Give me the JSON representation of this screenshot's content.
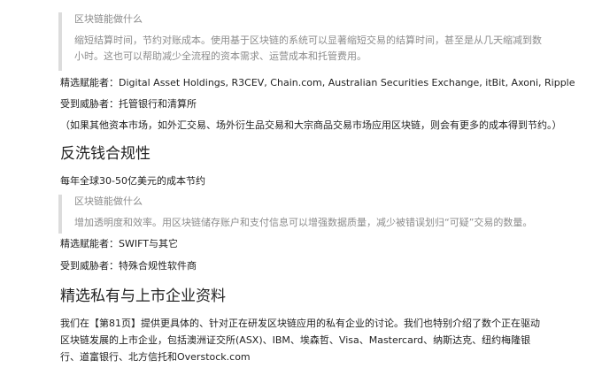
{
  "quote1": {
    "title": "区块链能做什么",
    "body": "缩短结算时间，节约对账成本。使用基于区块链的系统可以显著缩短交易的结算时间，甚至是从几天缩减到数小时。这也可以帮助减少全流程的资本需求、运营成本和托管费用。"
  },
  "enablers1": "精选赋能者：Digital Asset Holdings, R3CEV, Chain.com, Australian Securities Exchange, itBit, Axoni, Ripple",
  "threatened1": "受到威胁者：托管银行和清算所",
  "note1": "（如果其他资本市场，如外汇交易、场外衍生品交易和大宗商品交易市场应用区块链，则会有更多的成本得到节约。）",
  "section_aml": {
    "heading": "反洗钱合规性",
    "savings": "每年全球30-50亿美元的成本节约",
    "quote": {
      "title": "区块链能做什么",
      "body": "增加透明度和效率。用区块链储存账户和支付信息可以增强数据质量，减少被错误划归“可疑”交易的数量。"
    },
    "enablers": "精选赋能者：SWIFT与其它",
    "threatened": "受到威胁者：特殊合规性软件商"
  },
  "section_companies": {
    "heading": "精选私有与上市企业资料",
    "paragraph": "我们在【第81页】提供更具体的、针对正在研发区块链应用的私有企业的讨论。我们也特别介绍了数个正在驱动区块链发展的上市企业，包括澳洲证交所(ASX)、IBM、埃森哲、Visa、Mastercard、纳斯达克、纽约梅隆银行、道富银行、北方信托和Overstock.com"
  }
}
